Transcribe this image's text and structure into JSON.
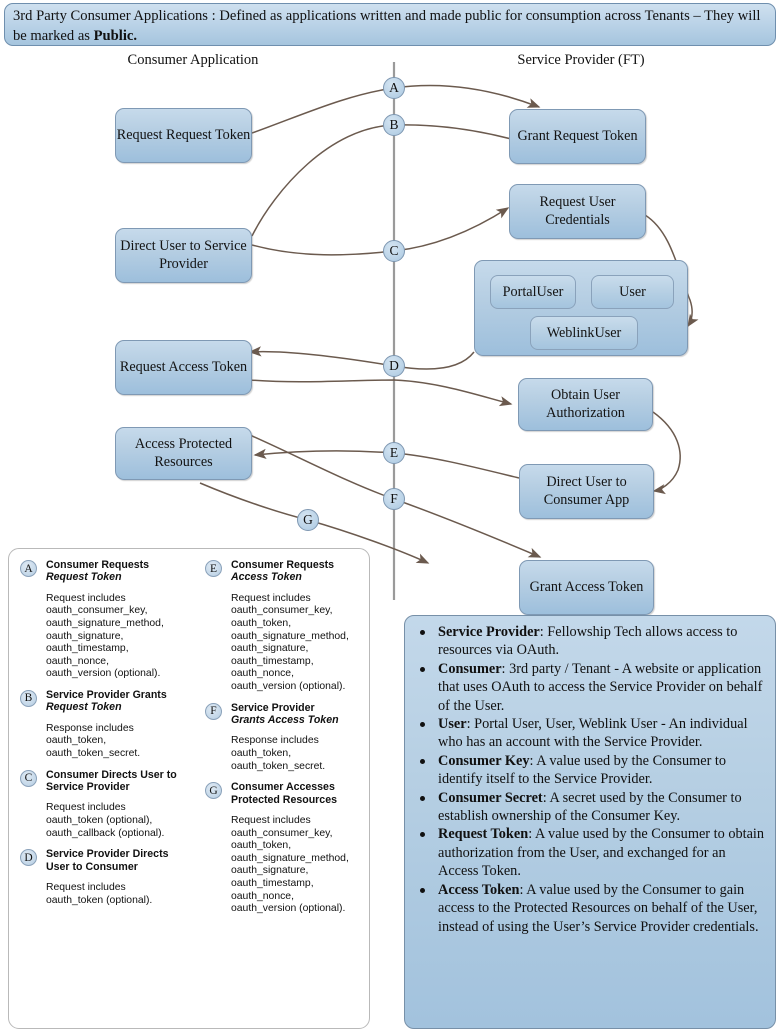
{
  "banner": {
    "lead": "3rd Party Consumer Applications",
    "rest": "  : Defined as applications written and made public for consumption across Tenants – They will be marked as ",
    "emphasis": "Public."
  },
  "columns": {
    "left_caption": "Consumer Application",
    "right_caption": "Service Provider (FT)"
  },
  "boxes": {
    "request_request_token": "Request\nRequest Token",
    "grant_request_token": "Grant\nRequest Token",
    "direct_user_to_service_provider": "Direct User to\nService Provider",
    "request_user_credentials": "Request\nUser Credentials",
    "portal_user": "PortalUser",
    "user": "User",
    "weblink_user": "WeblinkUser",
    "request_access_token": "Request\nAccess Token",
    "obtain_user_authorization": "Obtain User\nAuthorization",
    "access_protected_resources": "Access Protected\nResources",
    "direct_user_to_consumer_app": "Direct User to\nConsumer App",
    "grant_access_token": "Grant\nAccess Token"
  },
  "step_markers": [
    "A",
    "B",
    "C",
    "D",
    "E",
    "F",
    "G"
  ],
  "legend": {
    "left": [
      {
        "key": "A",
        "title_line1": "Consumer Requests",
        "title_line2": "Request Token",
        "title_line2_italic": true,
        "body": "Request includes\noauth_consumer_key,\noauth_signature_method,\noauth_signature,\noauth_timestamp,\noauth_nonce,\noauth_version (optional)."
      },
      {
        "key": "B",
        "title_line1": "Service Provider Grants",
        "title_line2": "Request Token",
        "title_line2_italic": true,
        "body": "Response includes\noauth_token,\noauth_token_secret."
      },
      {
        "key": "C",
        "title_line1": "Consumer Directs User to",
        "title_line2": "Service Provider",
        "title_line2_italic": false,
        "body": "Request includes\noauth_token (optional),\noauth_callback (optional)."
      },
      {
        "key": "D",
        "title_line1": "Service Provider Directs",
        "title_line2": "User to Consumer",
        "title_line2_italic": false,
        "body": "Request includes\noauth_token (optional)."
      }
    ],
    "right": [
      {
        "key": "E",
        "title_line1": "Consumer Requests",
        "title_line2": "Access Token",
        "title_line2_italic": true,
        "body": "Request includes\noauth_consumer_key,\noauth_token,\noauth_signature_method,\noauth_signature,\noauth_timestamp,\noauth_nonce,\noauth_version (optional)."
      },
      {
        "key": "F",
        "title_line1": "Service Provider",
        "title_line2": "Grants Access Token",
        "title_line2_italic": true,
        "body": "Response includes\noauth_token,\noauth_token_secret."
      },
      {
        "key": "G",
        "title_line1": "Consumer Accesses",
        "title_line2": "Protected Resources",
        "title_line2_italic": false,
        "body": "Request includes\noauth_consumer_key,\noauth_token,\noauth_signature_method,\noauth_signature,\noauth_timestamp,\noauth_nonce,\noauth_version (optional)."
      }
    ]
  },
  "definitions": [
    {
      "term": "Service Provider",
      "text": ": Fellowship Tech allows access to resources via OAuth."
    },
    {
      "term": "Consumer",
      "text": ": 3rd party / Tenant - A website or application that uses OAuth to access the Service Provider on behalf of the User."
    },
    {
      "term": "User",
      "text": ": Portal User, User, Weblink User - An individual who has an account with the Service Provider."
    },
    {
      "term": "Consumer Key",
      "text": ": A value used by the Consumer to identify itself to the Service Provider."
    },
    {
      "term": "Consumer Secret",
      "text": ": A secret used by the Consumer to establish ownership of the Consumer Key."
    },
    {
      "term": "Request Token",
      "text": ": A value used by the Consumer to obtain authorization from the User, and exchanged for an Access Token."
    },
    {
      "term": "Access Token",
      "text": ": A value used by the Consumer to gain access to the Protected Resources on behalf of the User, instead of using the User’s Service Provider credentials."
    }
  ],
  "colors": {
    "box_fill_top": "#c6daeb",
    "box_fill_bottom": "#9dbfdc",
    "box_border": "#7f99b4",
    "banner_border": "#6f8fae",
    "arrow_stroke": "#6b5a4e",
    "divider": "#9a9a9a",
    "legend_panel_bg": "#ffffff"
  }
}
